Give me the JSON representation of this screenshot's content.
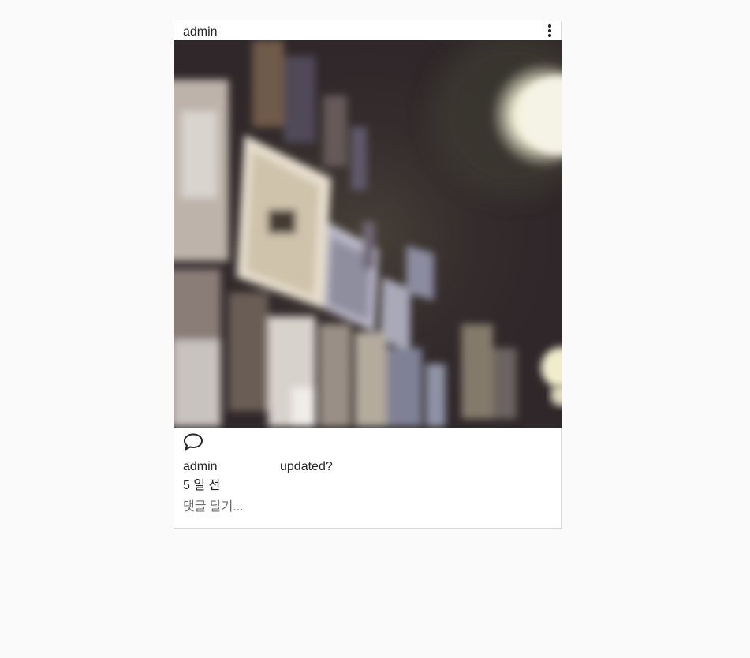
{
  "post": {
    "author": "admin",
    "caption_author": "admin",
    "caption_text": "updated?",
    "timestamp": "5 일 전",
    "comment_placeholder": "댓글 달기..."
  },
  "icons": {
    "more": "more-vertical-icon",
    "comment": "comment-bubble-icon"
  },
  "colors": {
    "background": "#fafafa",
    "card": "#ffffff",
    "border": "#dbdbdb",
    "text": "#262626",
    "placeholder": "#6b6b6b"
  }
}
